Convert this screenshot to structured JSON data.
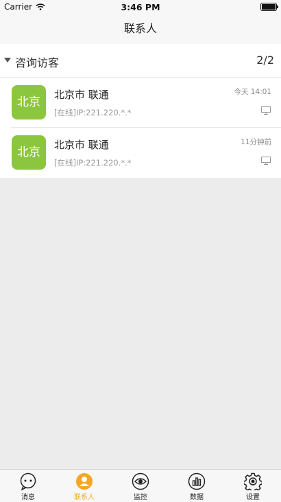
{
  "status_bar": {
    "carrier": "Carrier",
    "time": "3:46 PM"
  },
  "nav": {
    "title": "联系人"
  },
  "group": {
    "name": "咨询访客",
    "count": "2/2"
  },
  "contacts": [
    {
      "avatar_text": "北京",
      "title": "北京市 联通",
      "subtitle": "[在线]IP:221.220.*.*",
      "time": "今天 14:01"
    },
    {
      "avatar_text": "北京",
      "title": "北京市 联通",
      "subtitle": "[在线]IP:221.220.*.*",
      "time": "11分钟前"
    }
  ],
  "tabs": [
    {
      "label": "消息",
      "icon": "message-icon"
    },
    {
      "label": "联系人",
      "icon": "contacts-icon",
      "active": true
    },
    {
      "label": "监控",
      "icon": "eye-icon"
    },
    {
      "label": "数据",
      "icon": "chart-icon"
    },
    {
      "label": "设置",
      "icon": "gear-icon"
    }
  ],
  "colors": {
    "accent": "#f5a623",
    "avatar_bg": "#8cc63f"
  }
}
